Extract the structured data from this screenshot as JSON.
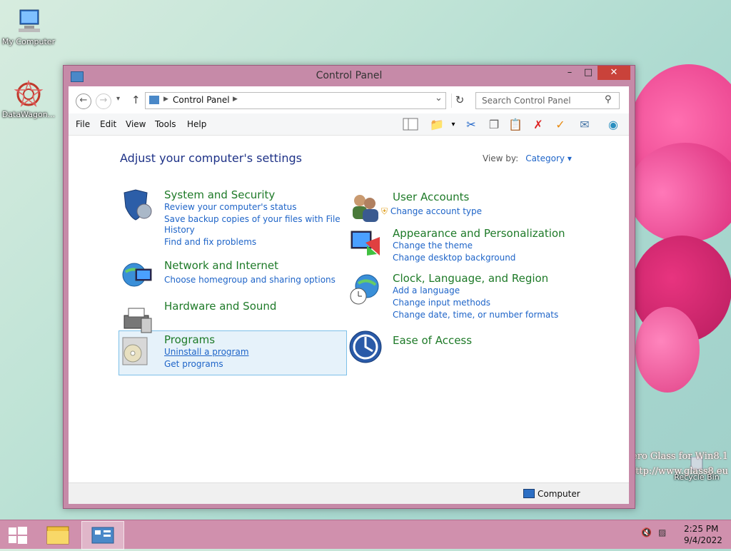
{
  "desktop": {
    "icons": [
      {
        "label": "My Computer"
      },
      {
        "label": "DataWagon..."
      },
      {
        "label": "Recycle Bin"
      }
    ],
    "watermark_line1": "ero Glass for Win8.1",
    "watermark_line2": "http://www.glass8.eu"
  },
  "window": {
    "title": "Control Panel",
    "minimize_label": "–",
    "maximize_label": "□",
    "close_label": "✕"
  },
  "address": {
    "breadcrumb": "Control Panel",
    "back_glyph": "←",
    "forward_glyph": "→",
    "up_glyph": "↑",
    "refresh_glyph": "↻",
    "dropdown_glyph": "⌄"
  },
  "search": {
    "placeholder": "Search Control Panel"
  },
  "menu": [
    "File",
    "Edit",
    "View",
    "Tools",
    "Help"
  ],
  "content": {
    "heading": "Adjust your computer's settings",
    "view_by_label": "View by:",
    "view_by_value": "Category ▾",
    "categories": [
      {
        "title": "System and Security",
        "links": [
          "Review your computer's status",
          "Save backup copies of your files with File",
          "History",
          "Find and fix problems"
        ]
      },
      {
        "title": "Network and Internet",
        "links": [
          "Choose homegroup and sharing options"
        ]
      },
      {
        "title": "Hardware and Sound",
        "links": []
      },
      {
        "title": "Programs",
        "links": [
          "Uninstall a program",
          "Get programs"
        ]
      },
      {
        "title": "User Accounts",
        "links": [
          "Change account type"
        ]
      },
      {
        "title": "Appearance and Personalization",
        "links": [
          "Change the theme",
          "Change desktop background"
        ]
      },
      {
        "title": "Clock, Language, and Region",
        "links": [
          "Add a language",
          "Change input methods",
          "Change date, time, or number formats"
        ]
      },
      {
        "title": "Ease of Access",
        "links": []
      }
    ]
  },
  "statusbar": {
    "text": "Computer"
  },
  "taskbar": {
    "time": "2:25 PM",
    "date": "9/4/2022"
  },
  "colors": {
    "window_frame": "#c68aa8",
    "category_title": "#1e7a28",
    "link": "#1e64c8",
    "heading": "#1e3287",
    "close_button": "#c9423a"
  }
}
